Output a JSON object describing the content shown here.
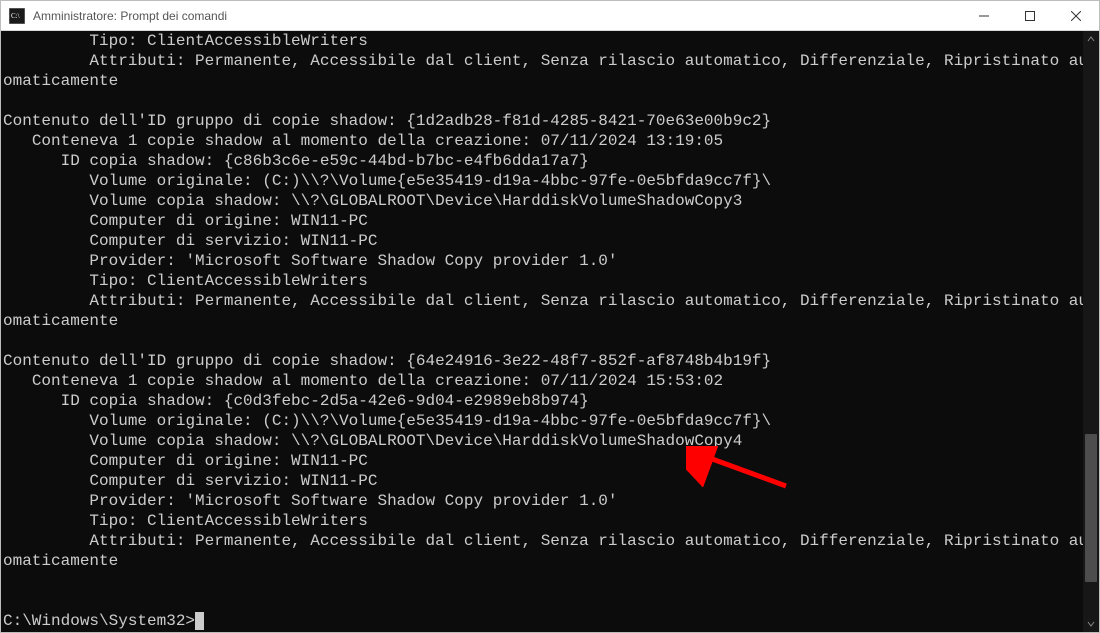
{
  "titlebar": {
    "title": "Amministratore: Prompt dei comandi"
  },
  "terminal": {
    "lines": [
      "         Tipo: ClientAccessibleWriters",
      "         Attributi: Permanente, Accessibile dal client, Senza rilascio automatico, Differenziale, Ripristinato automaticamente",
      "",
      "Contenuto dell'ID gruppo di copie shadow: {1d2adb28-f81d-4285-8421-70e63e00b9c2}",
      "   Conteneva 1 copie shadow al momento della creazione: 07/11/2024 13:19:05",
      "      ID copia shadow: {c86b3c6e-e59c-44bd-b7bc-e4fb6dda17a7}",
      "         Volume originale: (C:)\\\\?\\Volume{e5e35419-d19a-4bbc-97fe-0e5bfda9cc7f}\\",
      "         Volume copia shadow: \\\\?\\GLOBALROOT\\Device\\HarddiskVolumeShadowCopy3",
      "         Computer di origine: WIN11-PC",
      "         Computer di servizio: WIN11-PC",
      "         Provider: 'Microsoft Software Shadow Copy provider 1.0'",
      "         Tipo: ClientAccessibleWriters",
      "         Attributi: Permanente, Accessibile dal client, Senza rilascio automatico, Differenziale, Ripristinato automaticamente",
      "",
      "Contenuto dell'ID gruppo di copie shadow: {64e24916-3e22-48f7-852f-af8748b4b19f}",
      "   Conteneva 1 copie shadow al momento della creazione: 07/11/2024 15:53:02",
      "      ID copia shadow: {c0d3febc-2d5a-42e6-9d04-e2989eb8b974}",
      "         Volume originale: (C:)\\\\?\\Volume{e5e35419-d19a-4bbc-97fe-0e5bfda9cc7f}\\",
      "         Volume copia shadow: \\\\?\\GLOBALROOT\\Device\\HarddiskVolumeShadowCopy4",
      "         Computer di origine: WIN11-PC",
      "         Computer di servizio: WIN11-PC",
      "         Provider: 'Microsoft Software Shadow Copy provider 1.0'",
      "         Tipo: ClientAccessibleWriters",
      "         Attributi: Permanente, Accessibile dal client, Senza rilascio automatico, Differenziale, Ripristinato automaticamente",
      "",
      ""
    ],
    "prompt": "C:\\Windows\\System32>"
  },
  "annotation": {
    "arrow_color": "#ff0000",
    "target_desc": "HarddiskVolumeShadowCopy4 line"
  }
}
